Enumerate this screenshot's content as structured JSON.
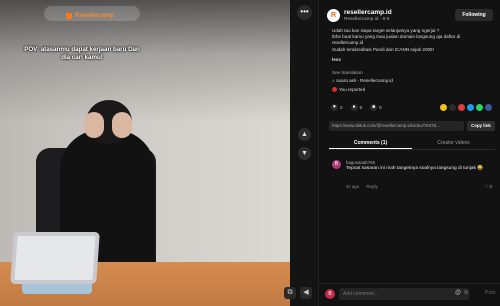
{
  "video": {
    "brand_name": "Resellercamp",
    "caption": "POV: atasanmu dapat kerjaan baru Dan dia cari kamu!"
  },
  "controls": {
    "more": "•••",
    "prev": "▲",
    "next": "▼"
  },
  "author": {
    "avatar_letter": "R",
    "name": "resellercamp.id",
    "sub": "Resellercamp.id · 6-5",
    "follow_label": "Following"
  },
  "description": {
    "line1": "Udah tau kan siapa target selanjutnya yang ngerjai ?",
    "line2": "Ibhe buat kamu yang mau jualan domain langsung aja daftar di resellercamp.id",
    "line3": "Sudah terakreditasi Pandi dan ICANN sejak 2009!",
    "line4": "less",
    "see_translation": "See translation",
    "music": "suara asli - Resellercamp.id",
    "reported": "You reported"
  },
  "actions": {
    "likes": "2",
    "comments": "0",
    "saves": "0"
  },
  "share_colors": [
    "#f2c418",
    "#2b2b2b",
    "#e23b3b",
    "#1e9bf0",
    "#25d366",
    "#3b5998"
  ],
  "link": {
    "url": "https://www.tiktok.com/@resellercamp.id/video/76478...",
    "copy_label": "Copy link"
  },
  "tabs": [
    {
      "label": "Comments (1)"
    },
    {
      "label": "Creator videos"
    }
  ],
  "comment": {
    "avatar": "B",
    "user": "bagusaaab765",
    "text": "Tepoat sasaran ini mah tangetnya soalnya langsung di tunjak 😂",
    "time": "3c ago",
    "reply": "Reply",
    "likes": "0"
  },
  "add_comment": {
    "avatar": "B",
    "placeholder": "Add comment...",
    "post": "Post"
  }
}
